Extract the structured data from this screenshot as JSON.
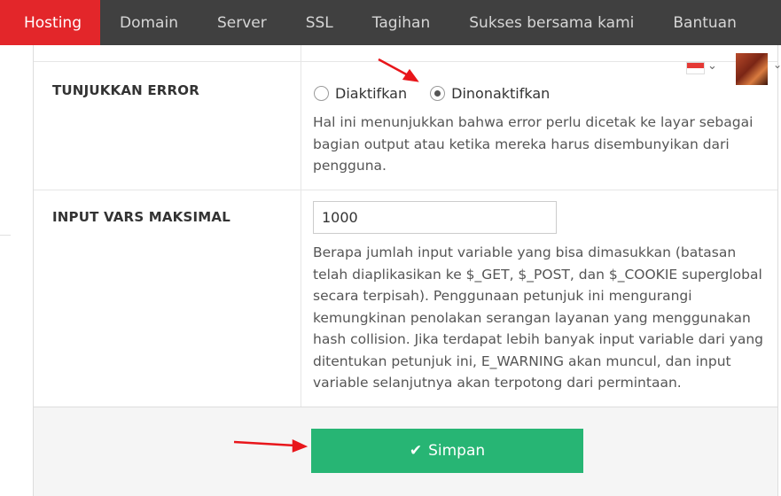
{
  "nav": {
    "items": [
      {
        "label": "Hosting",
        "active": true
      },
      {
        "label": "Domain",
        "active": false
      },
      {
        "label": "Server",
        "active": false
      },
      {
        "label": "SSL",
        "active": false
      },
      {
        "label": "Tagihan",
        "active": false
      },
      {
        "label": "Sukses bersama kami",
        "active": false
      },
      {
        "label": "Bantuan",
        "active": false
      }
    ]
  },
  "settings": {
    "show_errors": {
      "label": "TUNJUKKAN ERROR",
      "options": [
        {
          "label": "Diaktifkan",
          "checked": false
        },
        {
          "label": "Dinonaktifkan",
          "checked": true
        }
      ],
      "help": "Hal ini menunjukkan bahwa error perlu dicetak ke layar sebagai bagian output atau ketika mereka harus disembunyikan dari pengguna."
    },
    "max_input_vars": {
      "label": "INPUT VARS MAKSIMAL",
      "value": "1000",
      "help": "Berapa jumlah input variable yang bisa dimasukkan (batasan telah diaplikasikan ke $_GET, $_POST, dan $_COOKIE superglobal secara terpisah). Penggunaan petunjuk ini mengurangi kemungkinan penolakan serangan layanan yang menggunakan hash collision. Jika terdapat lebih banyak input variable dari yang ditentukan petunjuk ini, E_WARNING akan muncul, dan input variable selanjutnya akan terpotong dari permintaan."
    }
  },
  "actions": {
    "save_label": "Simpan"
  },
  "colors": {
    "nav_bg": "#404040",
    "nav_active": "#e3262a",
    "save_button": "#27b574",
    "annotation_arrow": "#e8161b"
  },
  "icons": {
    "save": "check-icon",
    "language": "indonesia-flag-icon"
  }
}
